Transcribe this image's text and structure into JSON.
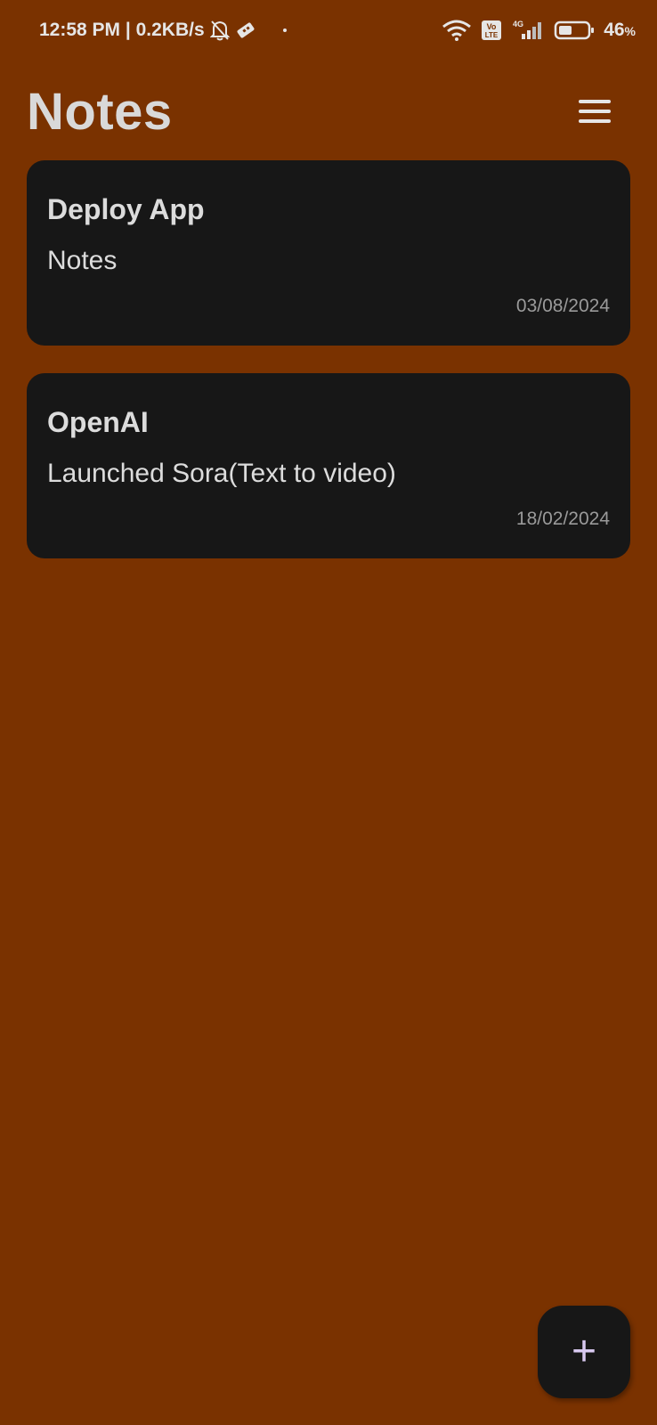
{
  "status_bar": {
    "time_speed": "12:58 PM | 0.2KB/s",
    "network_label": "4G",
    "volte_label": "Vo LTE",
    "battery_percent": "46",
    "battery_unit": "%",
    "battery_level": 0.46,
    "icons": [
      "bell-off-icon",
      "usb-icon",
      "wifi-icon",
      "volte-icon",
      "signal-icon",
      "battery-icon"
    ]
  },
  "header": {
    "title": "Notes",
    "menu_icon": "hamburger-menu-icon"
  },
  "notes": [
    {
      "title": "Deploy App",
      "body": "Notes",
      "date": "03/08/2024"
    },
    {
      "title": "OpenAI",
      "body": "Launched Sora(Text to video)",
      "date": "18/02/2024"
    }
  ],
  "fab": {
    "label": "+",
    "icon": "add-icon"
  },
  "colors": {
    "background": "#7a3200",
    "card": "#171717",
    "text": "#dcdcdc",
    "date_text": "#9a9a9a",
    "fab_icon": "#d8c9f0"
  }
}
